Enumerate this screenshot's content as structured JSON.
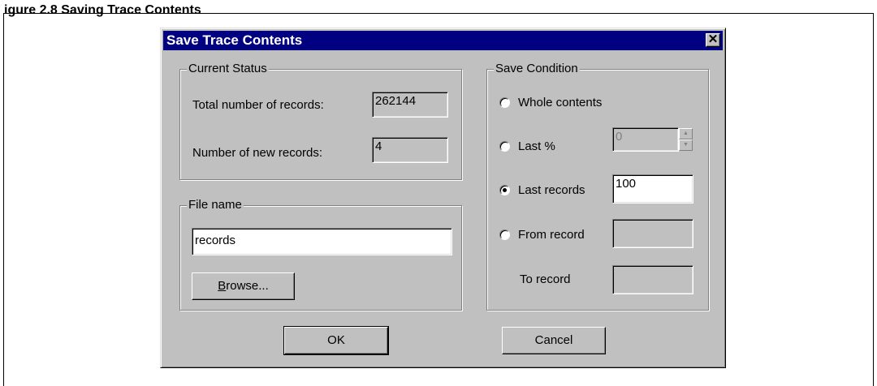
{
  "page": {
    "caption_fragment": "igure 2.8 Saving Trace Contents"
  },
  "dialog": {
    "title": "Save Trace Contents",
    "close_symbol": "✕",
    "current_status": {
      "legend": "Current Status",
      "total_label": "Total number of records:",
      "total_value": "262144",
      "new_label": "Number of new records:",
      "new_value": "4"
    },
    "file_name": {
      "legend": "File name",
      "value": "records",
      "browse_label": "Browse..."
    },
    "save_condition": {
      "legend": "Save Condition",
      "options": [
        {
          "label": "Whole contents",
          "checked": false
        },
        {
          "label": "Last %",
          "checked": false
        },
        {
          "label": "Last records",
          "checked": true
        },
        {
          "label": "From record",
          "checked": false
        }
      ],
      "last_percent_value": "0",
      "last_records_value": "100",
      "from_record_value": "",
      "to_record_label": "To record",
      "to_record_value": ""
    },
    "ok_label": "OK",
    "cancel_label": "Cancel"
  }
}
